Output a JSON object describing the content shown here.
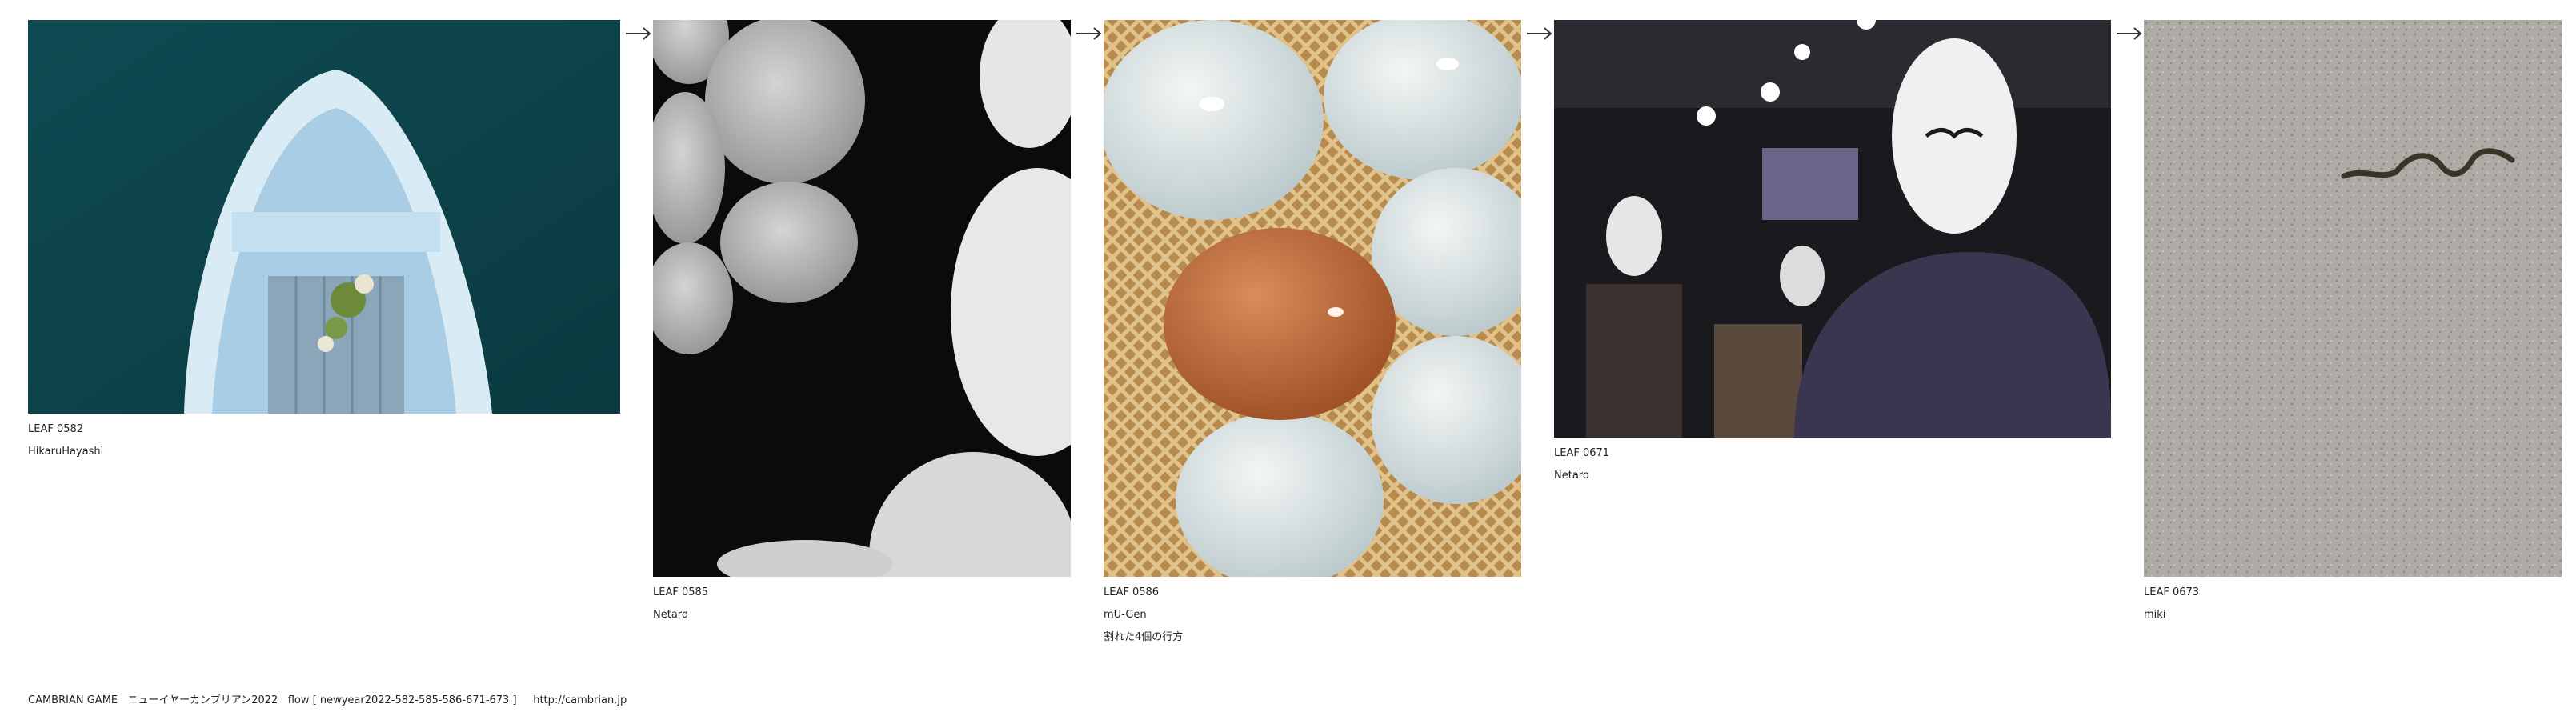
{
  "leaves": [
    {
      "id": "LEAF 0582",
      "author": "HikaruHayashi",
      "note": ""
    },
    {
      "id": "LEAF 0585",
      "author": "Netaro",
      "note": ""
    },
    {
      "id": "LEAF 0586",
      "author": "mU-Gen",
      "note": "割れた4個の行方"
    },
    {
      "id": "LEAF 0671",
      "author": "Netaro",
      "note": ""
    },
    {
      "id": "LEAF 0673",
      "author": "miki",
      "note": ""
    }
  ],
  "arrow_glyph": "→",
  "footer": {
    "game": "CAMBRIAN GAME",
    "title": "ニューイヤーカンブリアン2022",
    "flow": "flow [ newyear2022-582-585-586-671-673 ]",
    "url": "http://cambrian.jp"
  }
}
